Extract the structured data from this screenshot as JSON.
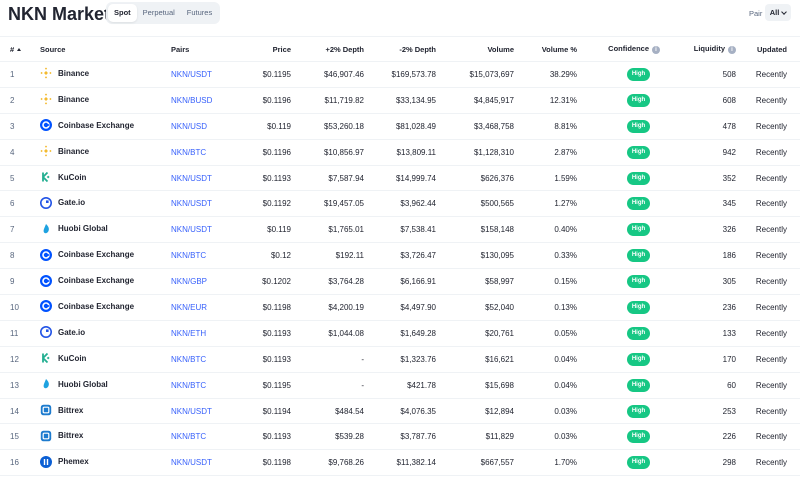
{
  "header": {
    "title": "NKN Markets",
    "tabs": [
      "Spot",
      "Perpetual",
      "Futures"
    ],
    "active_tab": "Spot",
    "pair_label": "Pair",
    "pair_value": "All"
  },
  "columns": {
    "num": "#",
    "source": "Source",
    "pairs": "Pairs",
    "price": "Price",
    "depth_plus": "+2% Depth",
    "depth_minus": "-2% Depth",
    "volume": "Volume",
    "volume_pct": "Volume %",
    "confidence": "Confidence",
    "liquidity": "Liquidity",
    "updated": "Updated"
  },
  "colors": {
    "accent": "#3861fb",
    "confidence_high": "#16c784",
    "binance": "#f3ba2f",
    "coinbase": "#0052ff",
    "kucoin": "#23af91",
    "gateio": "#2354e6",
    "huobi": "#1ea2e0",
    "bittrex": "#1d7bce",
    "phemex": "#0b5fd4"
  },
  "rows": [
    {
      "num": "1",
      "source": "Binance",
      "icon": "binance-icon",
      "pair": "NKN/USDT",
      "price": "$0.1195",
      "depth_plus": "$46,907.46",
      "depth_minus": "$169,573.78",
      "volume": "$15,073,697",
      "volume_pct": "38.29%",
      "confidence": "High",
      "liquidity": "508",
      "updated": "Recently"
    },
    {
      "num": "2",
      "source": "Binance",
      "icon": "binance-icon",
      "pair": "NKN/BUSD",
      "price": "$0.1196",
      "depth_plus": "$11,719.82",
      "depth_minus": "$33,134.95",
      "volume": "$4,845,917",
      "volume_pct": "12.31%",
      "confidence": "High",
      "liquidity": "608",
      "updated": "Recently"
    },
    {
      "num": "3",
      "source": "Coinbase Exchange",
      "icon": "coinbase-icon",
      "pair": "NKN/USD",
      "price": "$0.119",
      "depth_plus": "$53,260.18",
      "depth_minus": "$81,028.49",
      "volume": "$3,468,758",
      "volume_pct": "8.81%",
      "confidence": "High",
      "liquidity": "478",
      "updated": "Recently"
    },
    {
      "num": "4",
      "source": "Binance",
      "icon": "binance-icon",
      "pair": "NKN/BTC",
      "price": "$0.1196",
      "depth_plus": "$10,856.97",
      "depth_minus": "$13,809.11",
      "volume": "$1,128,310",
      "volume_pct": "2.87%",
      "confidence": "High",
      "liquidity": "942",
      "updated": "Recently"
    },
    {
      "num": "5",
      "source": "KuCoin",
      "icon": "kucoin-icon",
      "pair": "NKN/USDT",
      "price": "$0.1193",
      "depth_plus": "$7,587.94",
      "depth_minus": "$14,999.74",
      "volume": "$626,376",
      "volume_pct": "1.59%",
      "confidence": "High",
      "liquidity": "352",
      "updated": "Recently"
    },
    {
      "num": "6",
      "source": "Gate.io",
      "icon": "gateio-icon",
      "pair": "NKN/USDT",
      "price": "$0.1192",
      "depth_plus": "$19,457.05",
      "depth_minus": "$3,962.44",
      "volume": "$500,565",
      "volume_pct": "1.27%",
      "confidence": "High",
      "liquidity": "345",
      "updated": "Recently"
    },
    {
      "num": "7",
      "source": "Huobi Global",
      "icon": "huobi-icon",
      "pair": "NKN/USDT",
      "price": "$0.119",
      "depth_plus": "$1,765.01",
      "depth_minus": "$7,538.41",
      "volume": "$158,148",
      "volume_pct": "0.40%",
      "confidence": "High",
      "liquidity": "326",
      "updated": "Recently"
    },
    {
      "num": "8",
      "source": "Coinbase Exchange",
      "icon": "coinbase-icon",
      "pair": "NKN/BTC",
      "price": "$0.12",
      "depth_plus": "$192.11",
      "depth_minus": "$3,726.47",
      "volume": "$130,095",
      "volume_pct": "0.33%",
      "confidence": "High",
      "liquidity": "186",
      "updated": "Recently"
    },
    {
      "num": "9",
      "source": "Coinbase Exchange",
      "icon": "coinbase-icon",
      "pair": "NKN/GBP",
      "price": "$0.1202",
      "depth_plus": "$3,764.28",
      "depth_minus": "$6,166.91",
      "volume": "$58,997",
      "volume_pct": "0.15%",
      "confidence": "High",
      "liquidity": "305",
      "updated": "Recently"
    },
    {
      "num": "10",
      "source": "Coinbase Exchange",
      "icon": "coinbase-icon",
      "pair": "NKN/EUR",
      "price": "$0.1198",
      "depth_plus": "$4,200.19",
      "depth_minus": "$4,497.90",
      "volume": "$52,040",
      "volume_pct": "0.13%",
      "confidence": "High",
      "liquidity": "236",
      "updated": "Recently"
    },
    {
      "num": "11",
      "source": "Gate.io",
      "icon": "gateio-icon",
      "pair": "NKN/ETH",
      "price": "$0.1193",
      "depth_plus": "$1,044.08",
      "depth_minus": "$1,649.28",
      "volume": "$20,761",
      "volume_pct": "0.05%",
      "confidence": "High",
      "liquidity": "133",
      "updated": "Recently"
    },
    {
      "num": "12",
      "source": "KuCoin",
      "icon": "kucoin-icon",
      "pair": "NKN/BTC",
      "price": "$0.1193",
      "depth_plus": "-",
      "depth_minus": "$1,323.76",
      "volume": "$16,621",
      "volume_pct": "0.04%",
      "confidence": "High",
      "liquidity": "170",
      "updated": "Recently"
    },
    {
      "num": "13",
      "source": "Huobi Global",
      "icon": "huobi-icon",
      "pair": "NKN/BTC",
      "price": "$0.1195",
      "depth_plus": "-",
      "depth_minus": "$421.78",
      "volume": "$15,698",
      "volume_pct": "0.04%",
      "confidence": "High",
      "liquidity": "60",
      "updated": "Recently"
    },
    {
      "num": "14",
      "source": "Bittrex",
      "icon": "bittrex-icon",
      "pair": "NKN/USDT",
      "price": "$0.1194",
      "depth_plus": "$484.54",
      "depth_minus": "$4,076.35",
      "volume": "$12,894",
      "volume_pct": "0.03%",
      "confidence": "High",
      "liquidity": "253",
      "updated": "Recently"
    },
    {
      "num": "15",
      "source": "Bittrex",
      "icon": "bittrex-icon",
      "pair": "NKN/BTC",
      "price": "$0.1193",
      "depth_plus": "$539.28",
      "depth_minus": "$3,787.76",
      "volume": "$11,829",
      "volume_pct": "0.03%",
      "confidence": "High",
      "liquidity": "226",
      "updated": "Recently"
    },
    {
      "num": "16",
      "source": "Phemex",
      "icon": "phemex-icon",
      "pair": "NKN/USDT",
      "price": "$0.1198",
      "depth_plus": "$9,768.26",
      "depth_minus": "$11,382.14",
      "volume": "$667,557",
      "volume_pct": "1.70%",
      "confidence": "High",
      "liquidity": "298",
      "updated": "Recently"
    }
  ]
}
